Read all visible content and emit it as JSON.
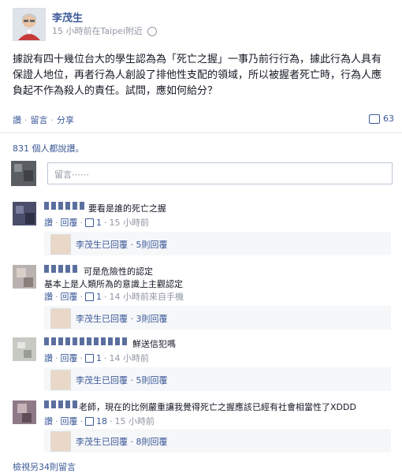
{
  "post": {
    "author": "李茂生",
    "time": "15 小時前在Taipei附近",
    "text": "據說有四十幾位台大的學生認為為「死亡之握」一事乃前行行為，據此行為人具有保證人地位，再者行為人創設了排他性支配的領域，所以被握者死亡時，行為人應負起不作為殺人的責任。試問，應如何給分？"
  },
  "actions": {
    "like": "讚",
    "comment": "留言",
    "share": "分享",
    "comment_count": "63"
  },
  "likes_text": "831 個人都說讚。",
  "reply_input": {
    "placeholder": "留言⋯⋯"
  },
  "comments": [
    {
      "text": "要看是誰的死亡之握",
      "meta": {
        "like": "讚",
        "reply": "回覆",
        "likes": "1",
        "time": "15 小時前"
      },
      "reply_summary": "李茂生已回覆 · 5則回覆"
    },
    {
      "text": "可是危險性的認定",
      "text2": "基本上是人類所為的意識上主觀認定",
      "meta": {
        "like": "讚",
        "reply": "回覆",
        "likes": "1",
        "time": "14 小時前來自手機"
      },
      "reply_summary": "李茂生已回覆 · 3則回覆"
    },
    {
      "text": "鮮送信犯嗎",
      "meta": {
        "like": "讚",
        "reply": "回覆",
        "likes": "1",
        "time": "14 小時前"
      },
      "reply_summary": "李茂生已回覆 · 5則回覆"
    },
    {
      "text": "老師，現在的比例嚴重讓我覺得死亡之握應該已經有社會相當性了XDDD",
      "meta": {
        "like": "讚",
        "reply": "回覆",
        "likes": "18",
        "time": "15 小時前"
      },
      "reply_summary": "李茂生已回覆 · 8則回覆"
    }
  ],
  "more_comments": "檢視另34則留言"
}
